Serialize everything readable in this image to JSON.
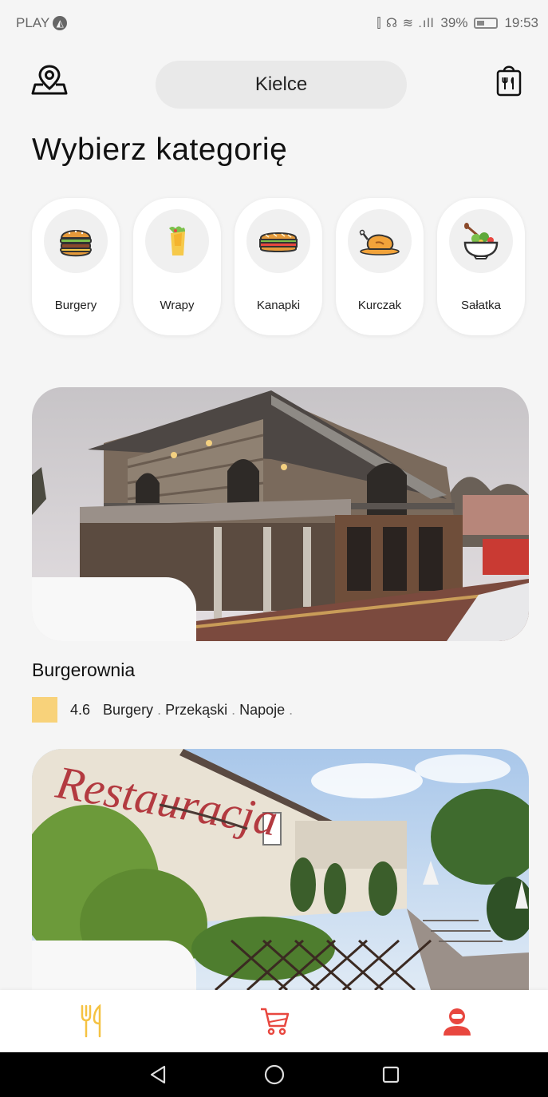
{
  "status_bar": {
    "carrier": "PLAY",
    "icons": "⫿ ☊ ≋ .ıll",
    "battery": "39%",
    "time": "19:53"
  },
  "header": {
    "city": "Kielce"
  },
  "page_title": "Wybierz kategorię",
  "categories": [
    {
      "label": "Burgery",
      "icon": "burger-icon"
    },
    {
      "label": "Wrapy",
      "icon": "wrap-icon"
    },
    {
      "label": "Kanapki",
      "icon": "sandwich-icon"
    },
    {
      "label": "Kurczak",
      "icon": "chicken-icon"
    },
    {
      "label": "Sałatka",
      "icon": "salad-icon"
    }
  ],
  "restaurants": [
    {
      "name": "Burgerownia",
      "rating": "4.6",
      "tags": [
        "Burgery",
        "Przekąski",
        "Napoje"
      ]
    },
    {
      "sign_text": "Restauracja"
    }
  ],
  "bottom_nav": [
    {
      "icon": "fork-knife-icon",
      "color": "#f5c242"
    },
    {
      "icon": "cart-icon",
      "color": "#e8473f"
    },
    {
      "icon": "profile-icon",
      "color": "#e8473f"
    }
  ],
  "colors": {
    "accent_yellow": "#f8d27a",
    "accent_red": "#e8473f",
    "background": "#f5f5f5"
  }
}
